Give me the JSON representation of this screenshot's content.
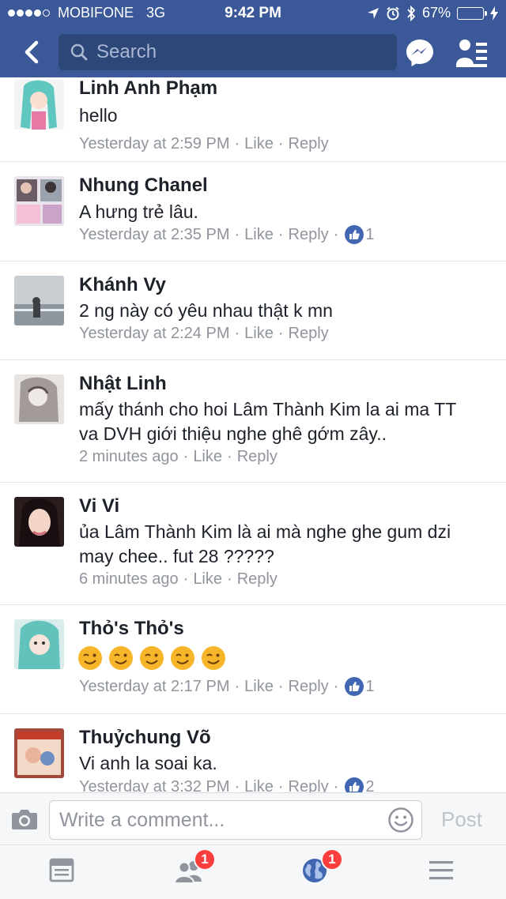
{
  "status_bar": {
    "carrier": "MOBIFONE",
    "network": "3G",
    "time": "9:42 PM",
    "battery": "67%",
    "battery_level": 0.67,
    "icons": [
      "signal-dots-icon",
      "location-arrow-icon",
      "alarm-clock-icon",
      "bluetooth-icon",
      "battery-icon"
    ]
  },
  "nav": {
    "back_icon": "chevron-left-icon",
    "search_placeholder": "Search",
    "messenger_icon": "messenger-icon",
    "profile_icon": "friend-requests-icon"
  },
  "comments": [
    {
      "name": "Linh Anh Phạm",
      "text": "hello",
      "time": "Yesterday at 2:59 PM",
      "like": "Like",
      "reply": "Reply",
      "likes": ""
    },
    {
      "name": "Nhung Chanel",
      "text": "A hưng trẻ lâu.",
      "time": "Yesterday at 2:35 PM",
      "like": "Like",
      "reply": "Reply",
      "likes": "1"
    },
    {
      "name": "Khánh Vy",
      "text": "2 ng này có yêu nhau thật k mn",
      "time": "Yesterday at 2:24 PM",
      "like": "Like",
      "reply": "Reply",
      "likes": ""
    },
    {
      "name": "Nhật Linh",
      "text_line1": "mấy thánh cho hoi Lâm Thành Kim la ai ma TT",
      "text_line2": "va DVH giới thiệu nghe ghê gớm zây..",
      "time": "2 minutes ago",
      "like": "Like",
      "reply": "Reply",
      "likes": ""
    },
    {
      "name": "Vi Vi",
      "text_line1": "ủa Lâm Thành Kim là ai mà nghe ghe gum dzi",
      "text_line2": "may chee.. fut 28 ?????",
      "time": "6 minutes ago",
      "like": "Like",
      "reply": "Reply",
      "likes": ""
    },
    {
      "name": "Thỏ's Thỏ's",
      "emoji": "winking-face",
      "emoji_count": 5,
      "time": "Yesterday at 2:17 PM",
      "like": "Like",
      "reply": "Reply",
      "likes": "1"
    },
    {
      "name": "Thuỷchung Võ",
      "text": "Vi anh la soai ka.",
      "time": "Yesterday at 3:32 PM",
      "like": "Like",
      "reply": "Reply",
      "likes": "2"
    }
  ],
  "separator": "·",
  "composer": {
    "placeholder": "Write a comment...",
    "post_label": "Post",
    "camera_icon": "camera-icon",
    "smiley_icon": "smiley-icon"
  },
  "tabbar": {
    "tabs": [
      {
        "icon": "news-feed-icon",
        "badge": ""
      },
      {
        "icon": "friends-icon",
        "badge": "1"
      },
      {
        "icon": "globe-notifications-icon",
        "badge": "1"
      },
      {
        "icon": "menu-icon",
        "badge": ""
      }
    ]
  },
  "colors": {
    "brand": "#3b5998",
    "like_blue": "#4267b2",
    "badge_red": "#fa3e3e",
    "meta_gray": "#90949c"
  }
}
